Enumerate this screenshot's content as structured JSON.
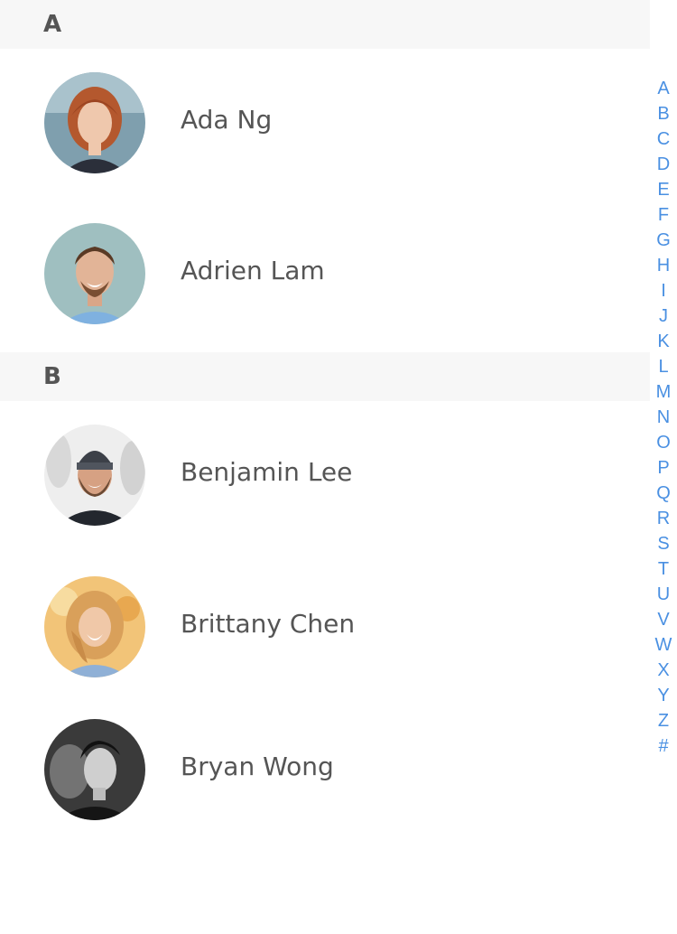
{
  "sections": [
    {
      "letter": "A",
      "contacts": [
        {
          "name": "Ada Ng",
          "avatar": "avatar-red-hair-woman"
        },
        {
          "name": "Adrien Lam",
          "avatar": "avatar-smiling-man"
        }
      ]
    },
    {
      "letter": "B",
      "contacts": [
        {
          "name": "Benjamin Lee",
          "avatar": "avatar-bearded-man-beanie"
        },
        {
          "name": "Brittany Chen",
          "avatar": "avatar-blonde-woman"
        },
        {
          "name": "Bryan Wong",
          "avatar": "avatar-bw-man"
        }
      ]
    }
  ],
  "index": [
    "A",
    "B",
    "C",
    "D",
    "E",
    "F",
    "G",
    "H",
    "I",
    "J",
    "K",
    "L",
    "M",
    "N",
    "O",
    "P",
    "Q",
    "R",
    "S",
    "T",
    "U",
    "V",
    "W",
    "X",
    "Y",
    "Z",
    "#"
  ],
  "colors": {
    "index_link": "#4a90e2",
    "section_bg": "#f7f7f7",
    "name_text": "#555555"
  }
}
